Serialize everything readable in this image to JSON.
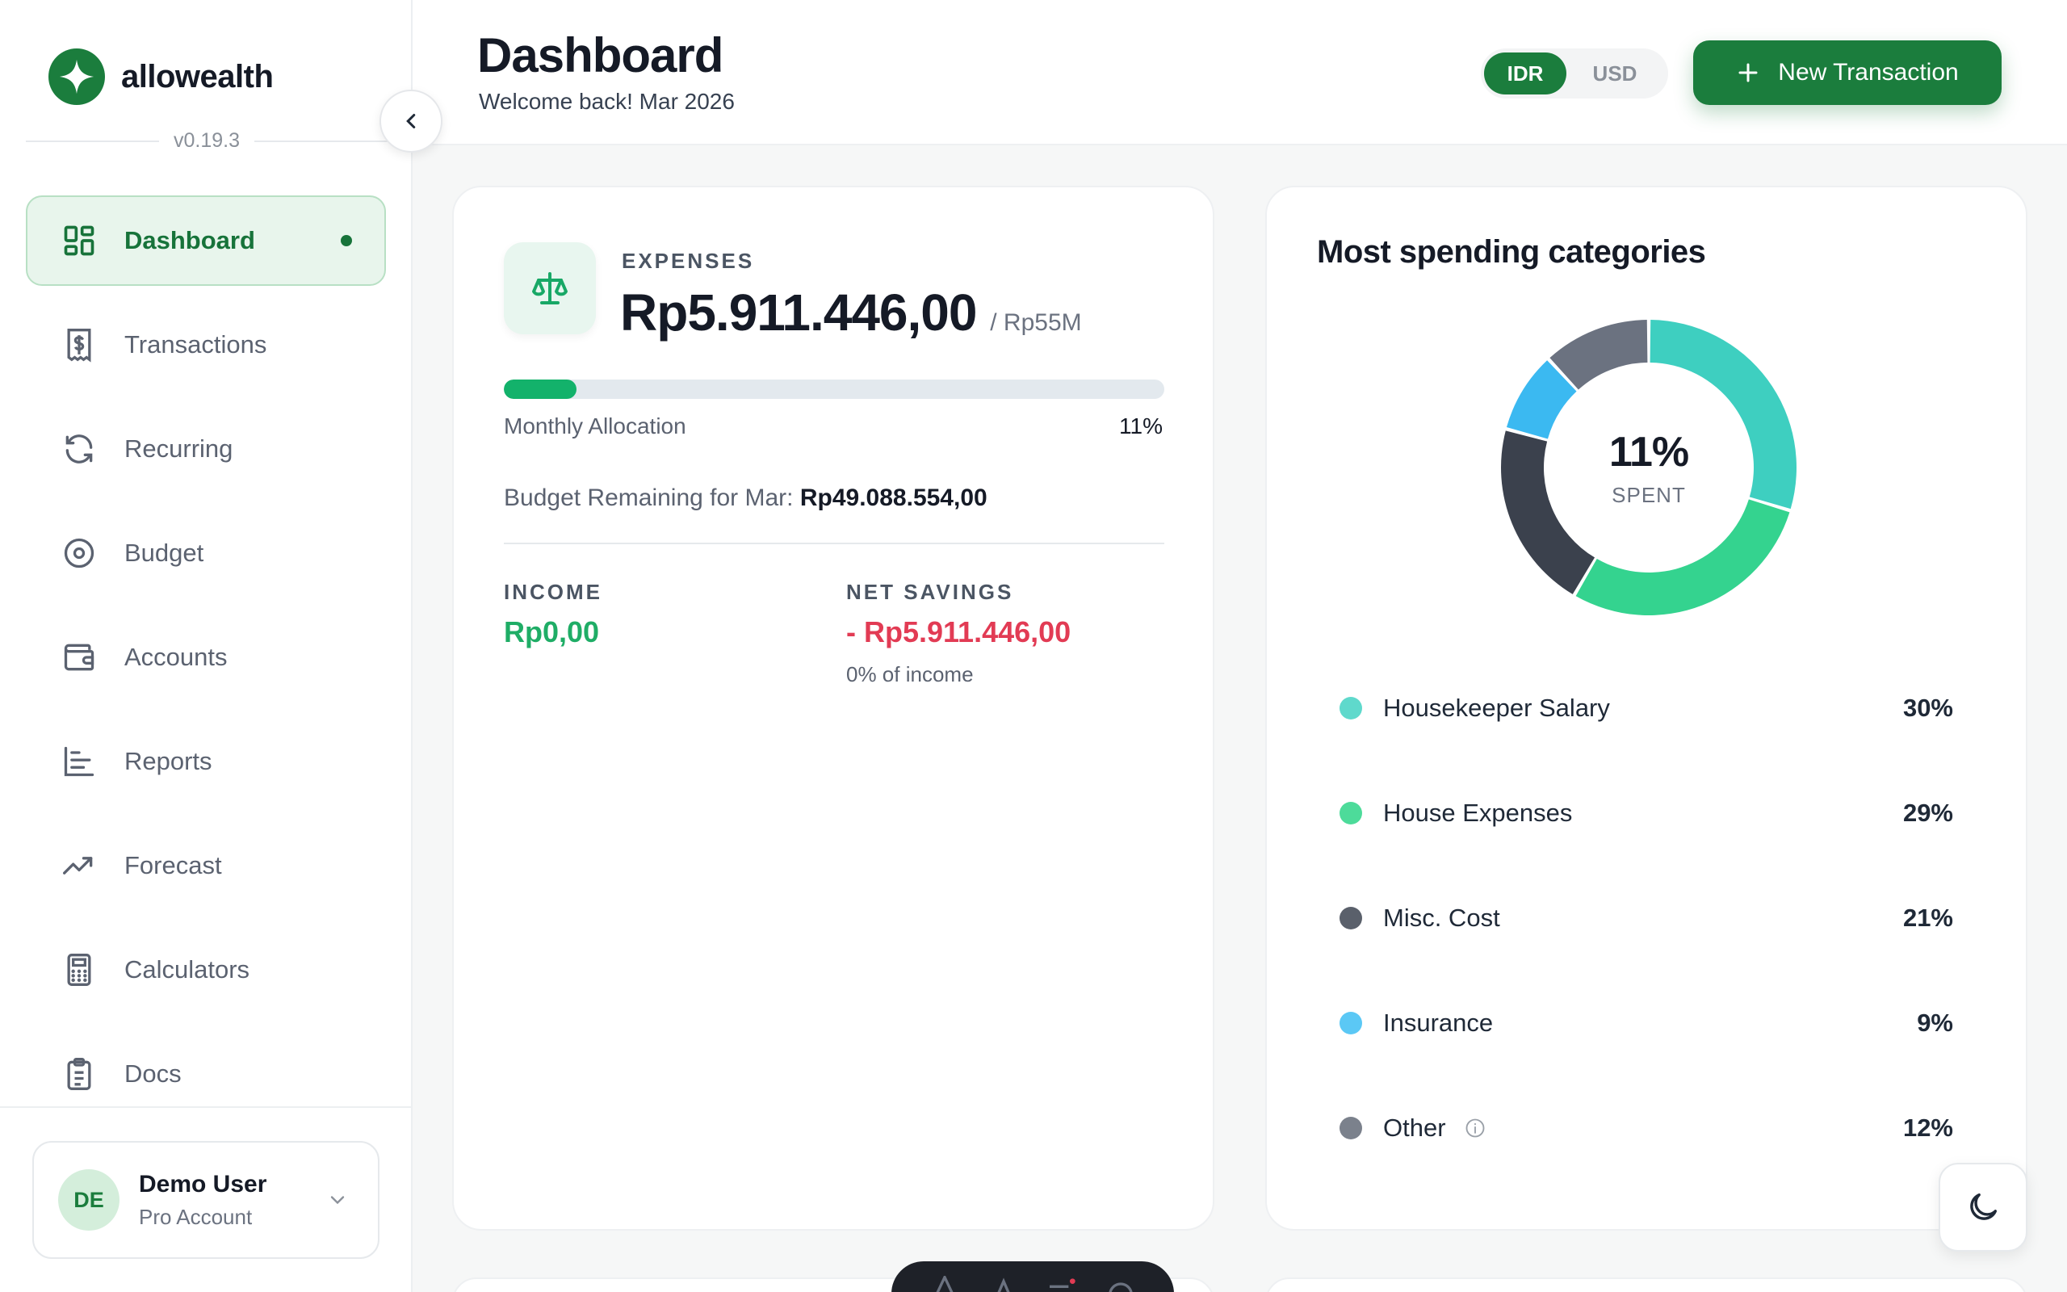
{
  "app": {
    "name": "allowealth",
    "version": "v0.19.3"
  },
  "sidebar": {
    "items": [
      {
        "label": "Dashboard",
        "icon": "dashboard-icon",
        "active": true
      },
      {
        "label": "Transactions",
        "icon": "receipt-icon"
      },
      {
        "label": "Recurring",
        "icon": "refresh-icon"
      },
      {
        "label": "Budget",
        "icon": "pie-target-icon"
      },
      {
        "label": "Accounts",
        "icon": "wallet-icon"
      },
      {
        "label": "Reports",
        "icon": "bar-chart-icon"
      },
      {
        "label": "Forecast",
        "icon": "trend-up-icon"
      },
      {
        "label": "Calculators",
        "icon": "calculator-icon"
      },
      {
        "label": "Docs",
        "icon": "clipboard-icon"
      }
    ],
    "user": {
      "initials": "DE",
      "name": "Demo User",
      "plan": "Pro Account"
    }
  },
  "header": {
    "title": "Dashboard",
    "subtitle": "Welcome back! Mar 2026",
    "currency": {
      "options": [
        "IDR",
        "USD"
      ],
      "selected": "IDR"
    },
    "new_transaction_label": "New Transaction"
  },
  "expenses": {
    "label": "EXPENSES",
    "amount": "Rp5.911.446,00",
    "budget": "/ Rp55M",
    "progress_fraction": 0.11,
    "allocation_label": "Monthly Allocation",
    "allocation_pct": "11%",
    "remaining_label": "Budget Remaining for Mar:",
    "remaining_value": "Rp49.088.554,00",
    "income_label": "INCOME",
    "income_value": "Rp0,00",
    "savings_label": "NET SAVINGS",
    "savings_value": "- Rp5.911.446,00",
    "savings_note": "0% of income"
  },
  "spending": {
    "title": "Most spending categories",
    "center_pct": "11%",
    "center_caption": "SPENT",
    "categories": [
      {
        "name": "Housekeeper Salary",
        "pct": "30%",
        "value": 30,
        "color": "#3ecfc0",
        "legend_color": "#5fd9cc"
      },
      {
        "name": "House Expenses",
        "pct": "29%",
        "value": 29,
        "color": "#34d38f",
        "legend_color": "#4ddb9a"
      },
      {
        "name": "Misc. Cost",
        "pct": "21%",
        "value": 21,
        "color": "#3b414d",
        "legend_color": "#5a606b"
      },
      {
        "name": "Insurance",
        "pct": "9%",
        "value": 9,
        "color": "#3bb9f1",
        "legend_color": "#5bc8f5"
      },
      {
        "name": "Other",
        "pct": "12%",
        "value": 12,
        "color": "#6b7280",
        "legend_color": "#7b818c",
        "info": true
      }
    ]
  },
  "colors": {
    "brand": "#1b7d3d",
    "income": "#1fad66",
    "negative": "#e23b54"
  }
}
